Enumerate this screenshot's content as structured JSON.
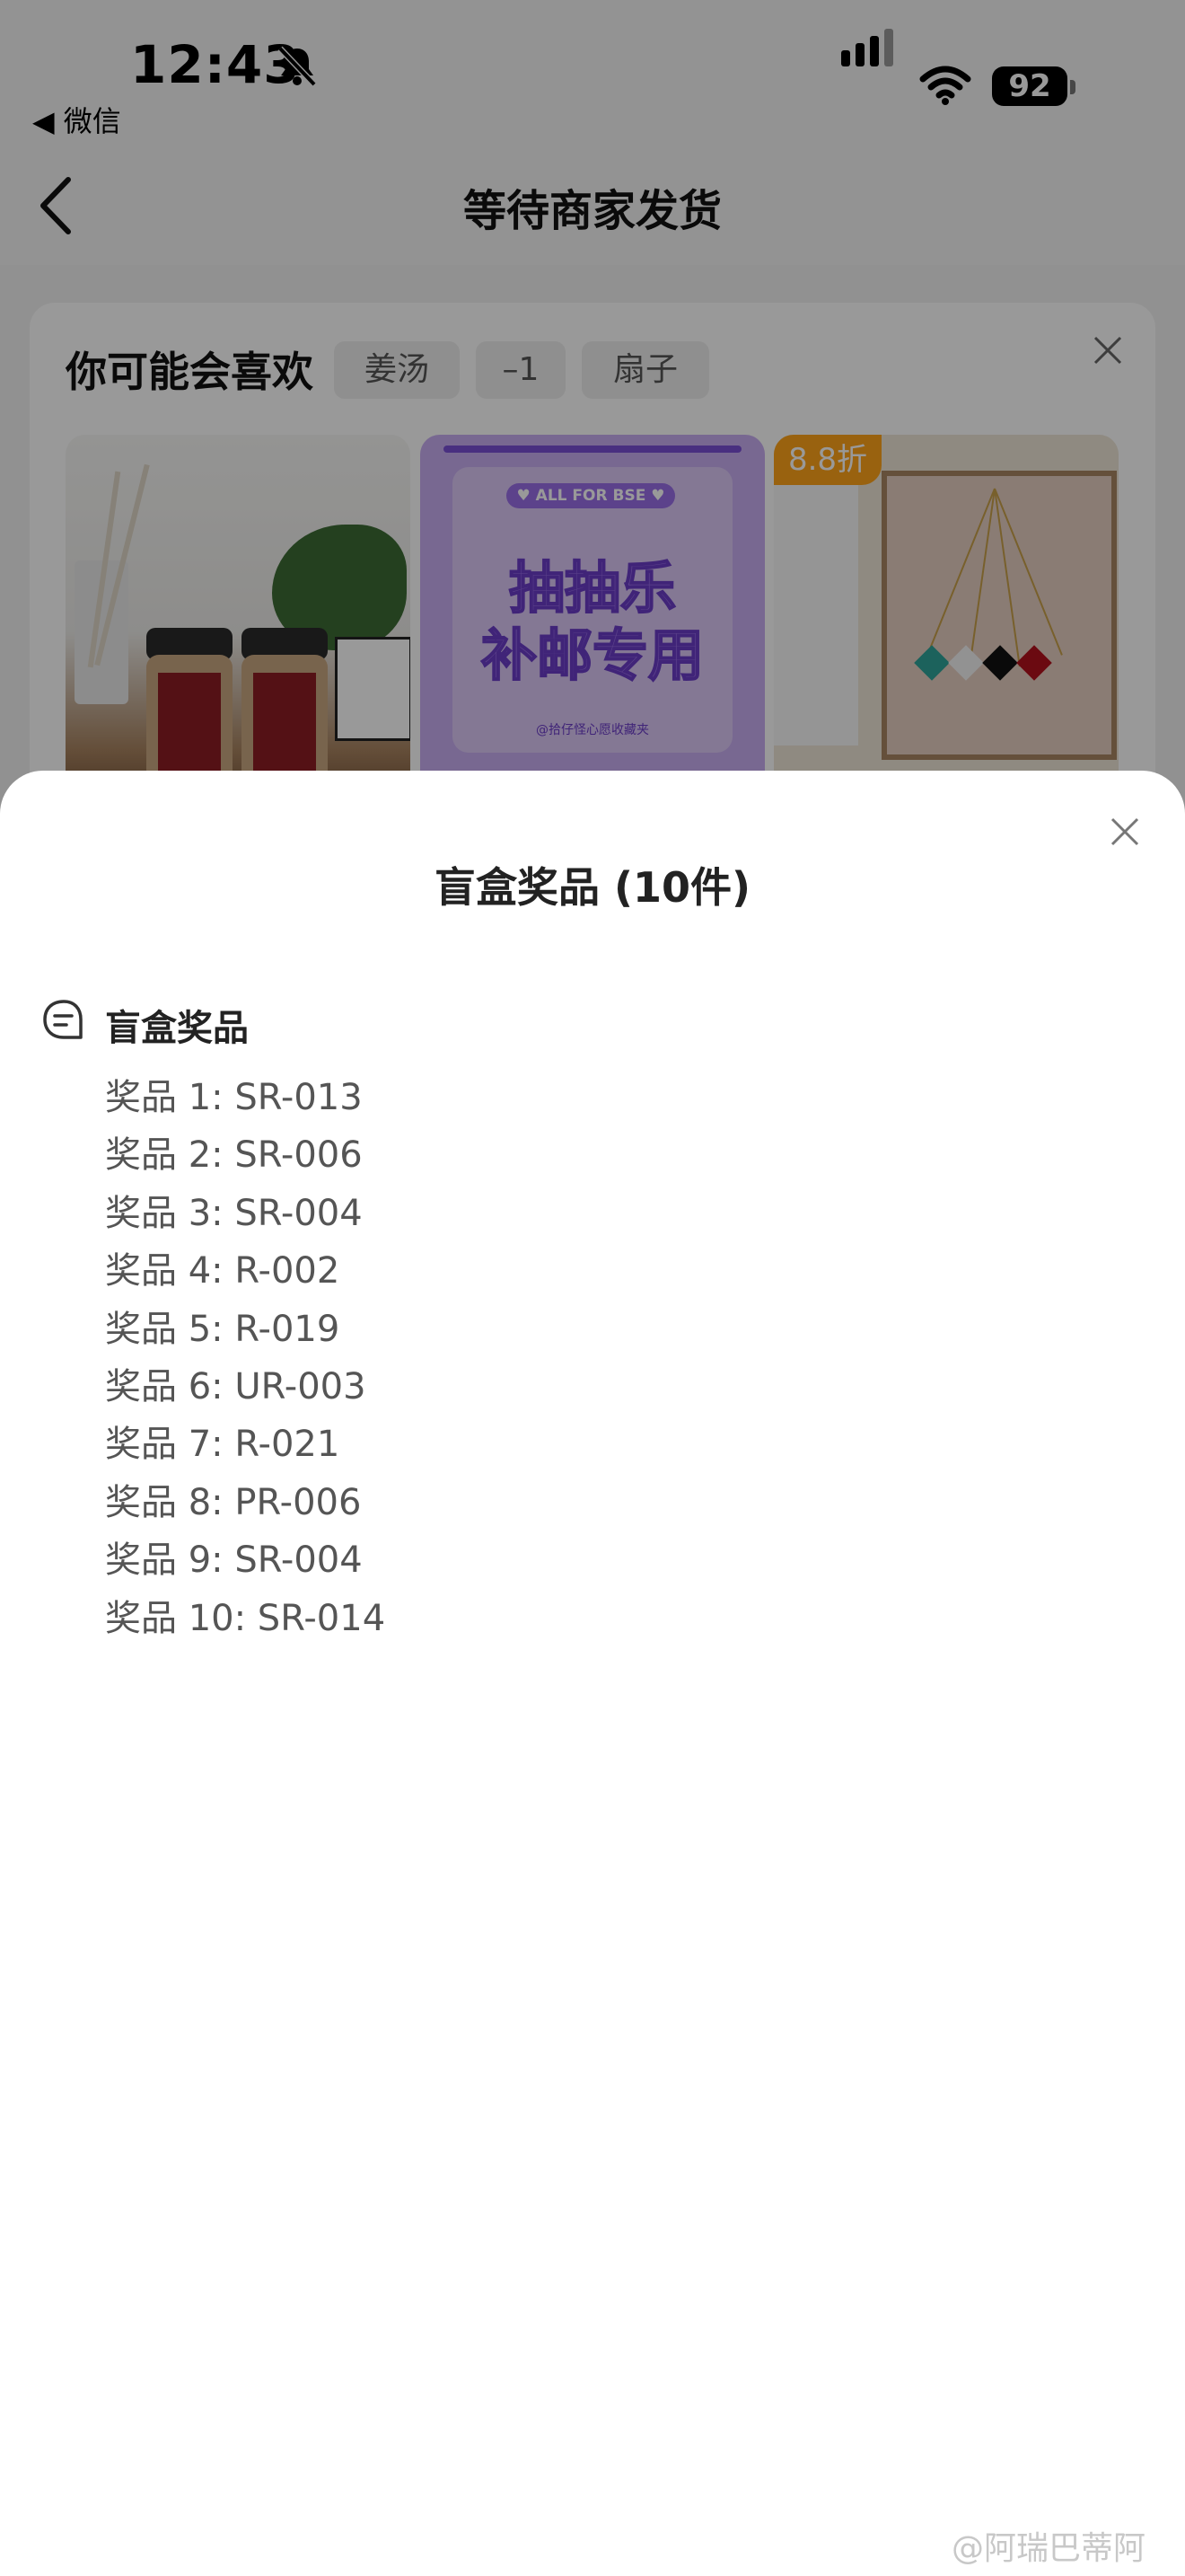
{
  "status_bar": {
    "time": "12:43",
    "back_app": "◀ 微信",
    "battery": "92"
  },
  "nav": {
    "title": "等待商家发货"
  },
  "recommendations": {
    "title": "你可能会喜欢",
    "chips": [
      "姜汤",
      "–1",
      "扇子"
    ],
    "products": [
      {
        "image": "ginger-jars-photo"
      },
      {
        "image": "lottery-card-graphic",
        "pill": "♥ ALL FOR BSE ♥",
        "line1": "抽抽乐",
        "line2": "补邮专用",
        "small": "@拾仔怪心愿收藏夹"
      },
      {
        "image": "necklace-photo",
        "badge": "8.8折"
      }
    ]
  },
  "sheet": {
    "title": "盲盒奖品 (10件)",
    "section_title": "盲盒奖品",
    "prizes": [
      "奖品 1: SR-013",
      "奖品 2: SR-006",
      "奖品 3: SR-004",
      "奖品 4: R-002",
      "奖品 5: R-019",
      "奖品 6: UR-003",
      "奖品 7: R-021",
      "奖品 8: PR-006",
      "奖品 9: SR-004",
      "奖品 10: SR-014"
    ]
  },
  "watermark": "@阿瑞巴蒂阿",
  "colors": {
    "overlay": "#000000",
    "sheet": "#ffffff",
    "discount_badge": "#ffa31a",
    "lottery_purple": "#9a6ee8"
  }
}
